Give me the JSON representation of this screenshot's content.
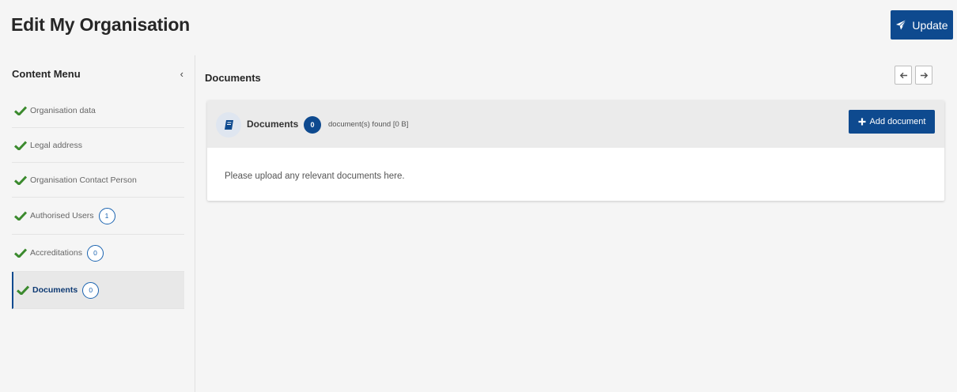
{
  "header": {
    "title": "Edit My Organisation",
    "update_label": "Update"
  },
  "sidebar": {
    "title": "Content Menu",
    "collapse_glyph": "‹",
    "items": [
      {
        "label": "Organisation data",
        "status": "complete"
      },
      {
        "label": "Legal address",
        "status": "complete"
      },
      {
        "label": "Organisation Contact Person",
        "status": "complete"
      },
      {
        "label": "Authorised Users",
        "count": "1",
        "status": "complete"
      },
      {
        "label": "Accreditations",
        "count": "0",
        "status": "complete"
      },
      {
        "label": "Documents",
        "count": "0",
        "status": "complete",
        "active": true
      }
    ]
  },
  "main": {
    "title": "Documents",
    "panel": {
      "heading": "Documents",
      "count": "0",
      "found_text": "document(s) found [0 B]",
      "add_label": "Add document",
      "body_text": "Please upload any relevant documents here."
    }
  },
  "colors": {
    "primary": "#0e4a8f",
    "check_green": "#3b8a2e",
    "badge_outline": "#1a63b0"
  },
  "icons": {
    "update": "paper-plane-icon",
    "check": "check-icon",
    "nav_back": "arrow-left-icon",
    "nav_forward": "arrow-right-icon",
    "documents": "book-icon",
    "add": "plus-icon"
  }
}
